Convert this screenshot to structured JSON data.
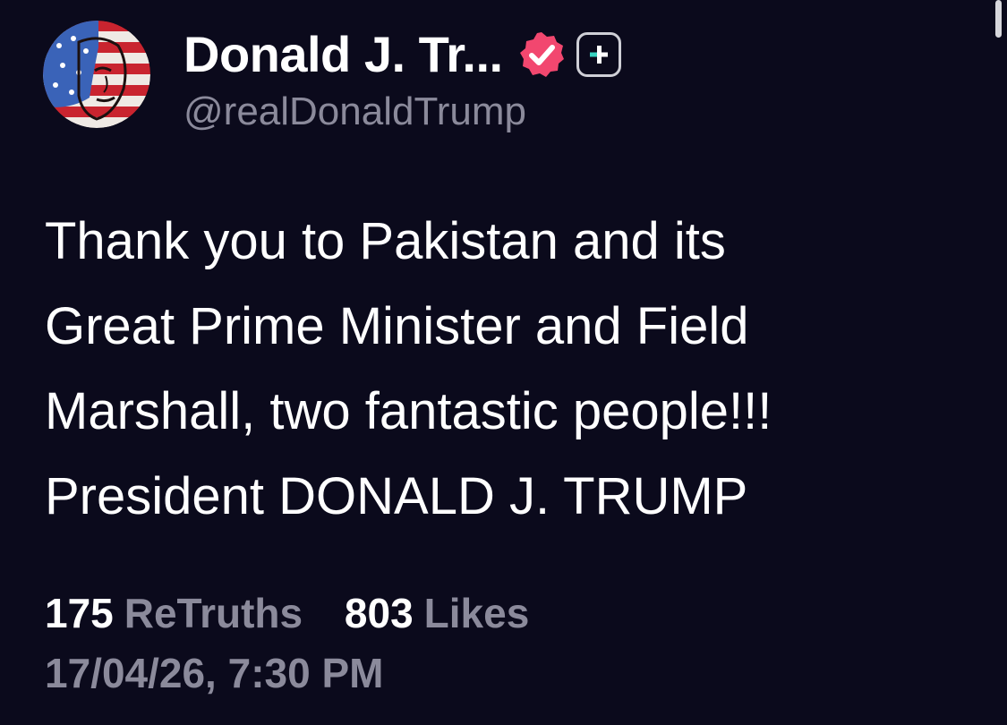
{
  "account": {
    "display_name": "Donald J. Tr...",
    "handle": "@realDonaldTrump",
    "verified_icon": "verified-badge-icon",
    "follow_icon": "plus-icon",
    "avatar": "profile-avatar"
  },
  "post": {
    "lines": [
      "Thank you to Pakistan and its",
      "Great Prime Minister and Field",
      "Marshall, two fantastic people!!!",
      "President DONALD J. TRUMP"
    ]
  },
  "stats": {
    "retruths_count": "175",
    "retruths_label": "ReTruths",
    "likes_count": "803",
    "likes_label": "Likes"
  },
  "timestamp": "17/04/26, 7:30 PM",
  "colors": {
    "background": "#0b0a1c",
    "muted_text": "#8b8a9b",
    "verified_badge": "#f2476f"
  }
}
